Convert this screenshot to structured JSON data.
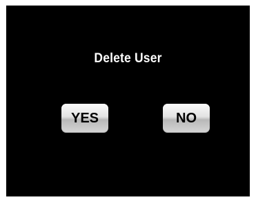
{
  "dialog": {
    "title": "Delete User",
    "yes_label": "YES",
    "no_label": "NO"
  },
  "colors": {
    "background": "#000000",
    "title_text": "#ffffff",
    "button_text": "#000000",
    "frame": "#ffffff"
  }
}
